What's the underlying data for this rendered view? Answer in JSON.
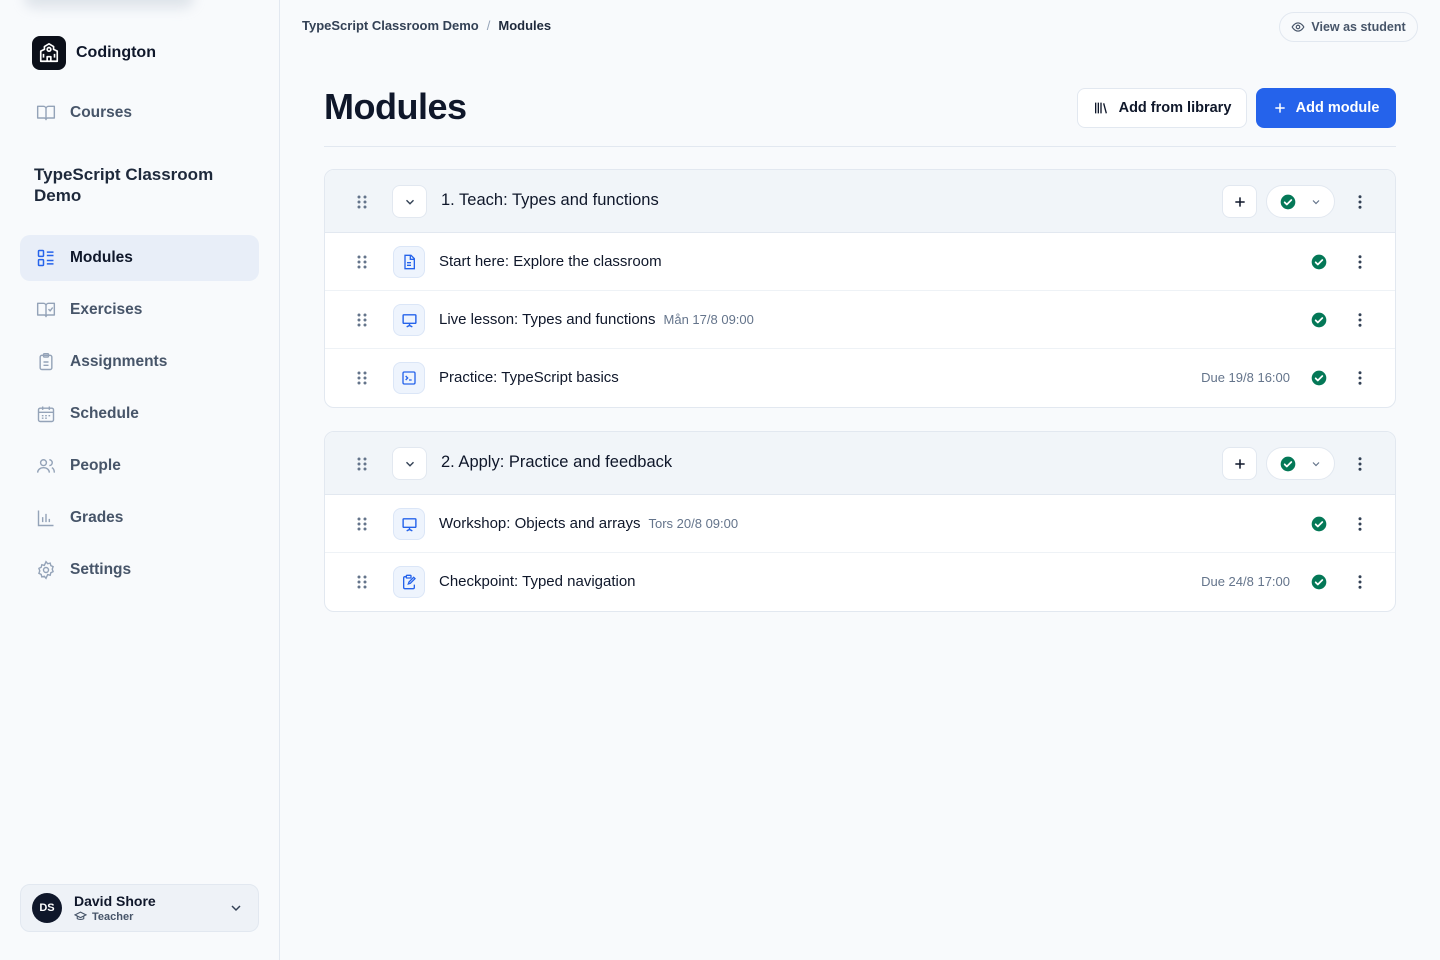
{
  "app": {
    "name": "Codington"
  },
  "sidebar": {
    "courses_label": "Courses",
    "course_title": "TypeScript Classroom Demo",
    "items": [
      {
        "label": "Modules",
        "icon": "modules-icon",
        "active": true
      },
      {
        "label": "Exercises",
        "icon": "exercises-icon"
      },
      {
        "label": "Assignments",
        "icon": "assignments-icon"
      },
      {
        "label": "Schedule",
        "icon": "calendar-icon"
      },
      {
        "label": "People",
        "icon": "people-icon"
      },
      {
        "label": "Grades",
        "icon": "grades-icon"
      },
      {
        "label": "Settings",
        "icon": "gear-icon"
      }
    ],
    "user": {
      "initials": "DS",
      "name": "David Shore",
      "role": "Teacher"
    }
  },
  "breadcrumb": {
    "course": "TypeScript Classroom Demo",
    "separator": "/",
    "current": "Modules"
  },
  "header": {
    "view_as_student": "View as student",
    "title": "Modules",
    "add_from_library": "Add from library",
    "add_module": "Add module"
  },
  "colors": {
    "accent": "#2563eb",
    "success": "#047857"
  },
  "modules": [
    {
      "title": "1. Teach: Types and functions",
      "items": [
        {
          "icon": "document-icon",
          "title": "Start here: Explore the classroom",
          "meta": "",
          "due": ""
        },
        {
          "icon": "presentation-icon",
          "title": "Live lesson: Types and functions",
          "meta": "Mån 17/8 09:00",
          "due": ""
        },
        {
          "icon": "terminal-icon",
          "title": "Practice: TypeScript basics",
          "meta": "",
          "due": "Due 19/8 16:00"
        }
      ]
    },
    {
      "title": "2. Apply: Practice and feedback",
      "items": [
        {
          "icon": "presentation-icon",
          "title": "Workshop: Objects and arrays",
          "meta": "Tors 20/8 09:00",
          "due": ""
        },
        {
          "icon": "clipboard-edit-icon",
          "title": "Checkpoint: Typed navigation",
          "meta": "",
          "due": "Due 24/8 17:00"
        }
      ]
    }
  ]
}
